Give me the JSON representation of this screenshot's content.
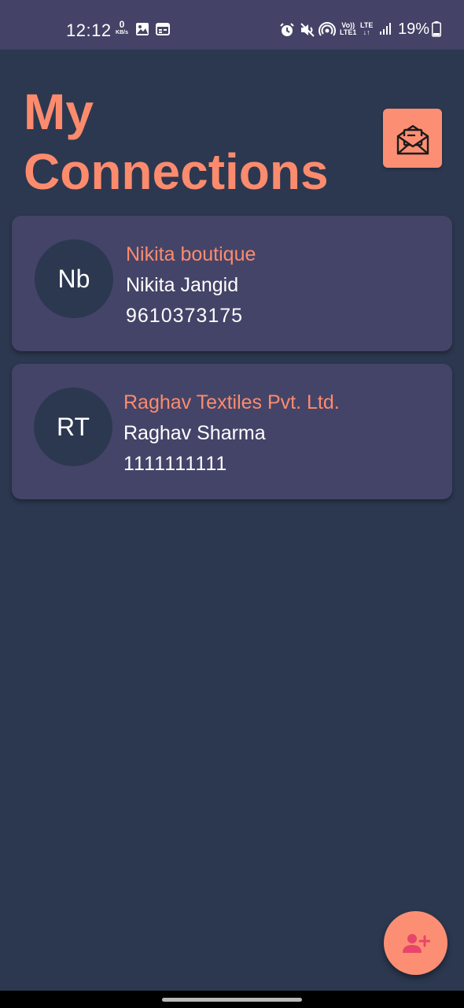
{
  "status_bar": {
    "time": "12:12",
    "net_speed_value": "0",
    "net_speed_unit": "KB/s",
    "volte_top": "Vo))",
    "volte_bottom": "LTE1",
    "lte_top": "LTE",
    "lte_bottom": "↓↑",
    "battery_percent": "19%",
    "icons": [
      "image-icon",
      "calendar-icon",
      "alarm-icon",
      "mute-icon",
      "hotspot-icon",
      "signal-icon",
      "battery-icon"
    ]
  },
  "header": {
    "title_line1": "My",
    "title_line2": "Connections",
    "inbox_icon": "mail-open-icon"
  },
  "connections": [
    {
      "initials": "Nb",
      "business": "Nikita boutique",
      "name": "Nikita Jangid",
      "phone": "9610373175"
    },
    {
      "initials": "RT",
      "business": "Raghav Textiles Pvt. Ltd.",
      "name": "Raghav Sharma",
      "phone": "1111111111"
    }
  ],
  "fab": {
    "icon": "add-person-icon"
  },
  "colors": {
    "background": "#2c3850",
    "status_bar": "#444266",
    "card": "#444468",
    "accent": "#fc8b6e",
    "fab_icon": "#e8456a",
    "text": "#ffffff"
  }
}
